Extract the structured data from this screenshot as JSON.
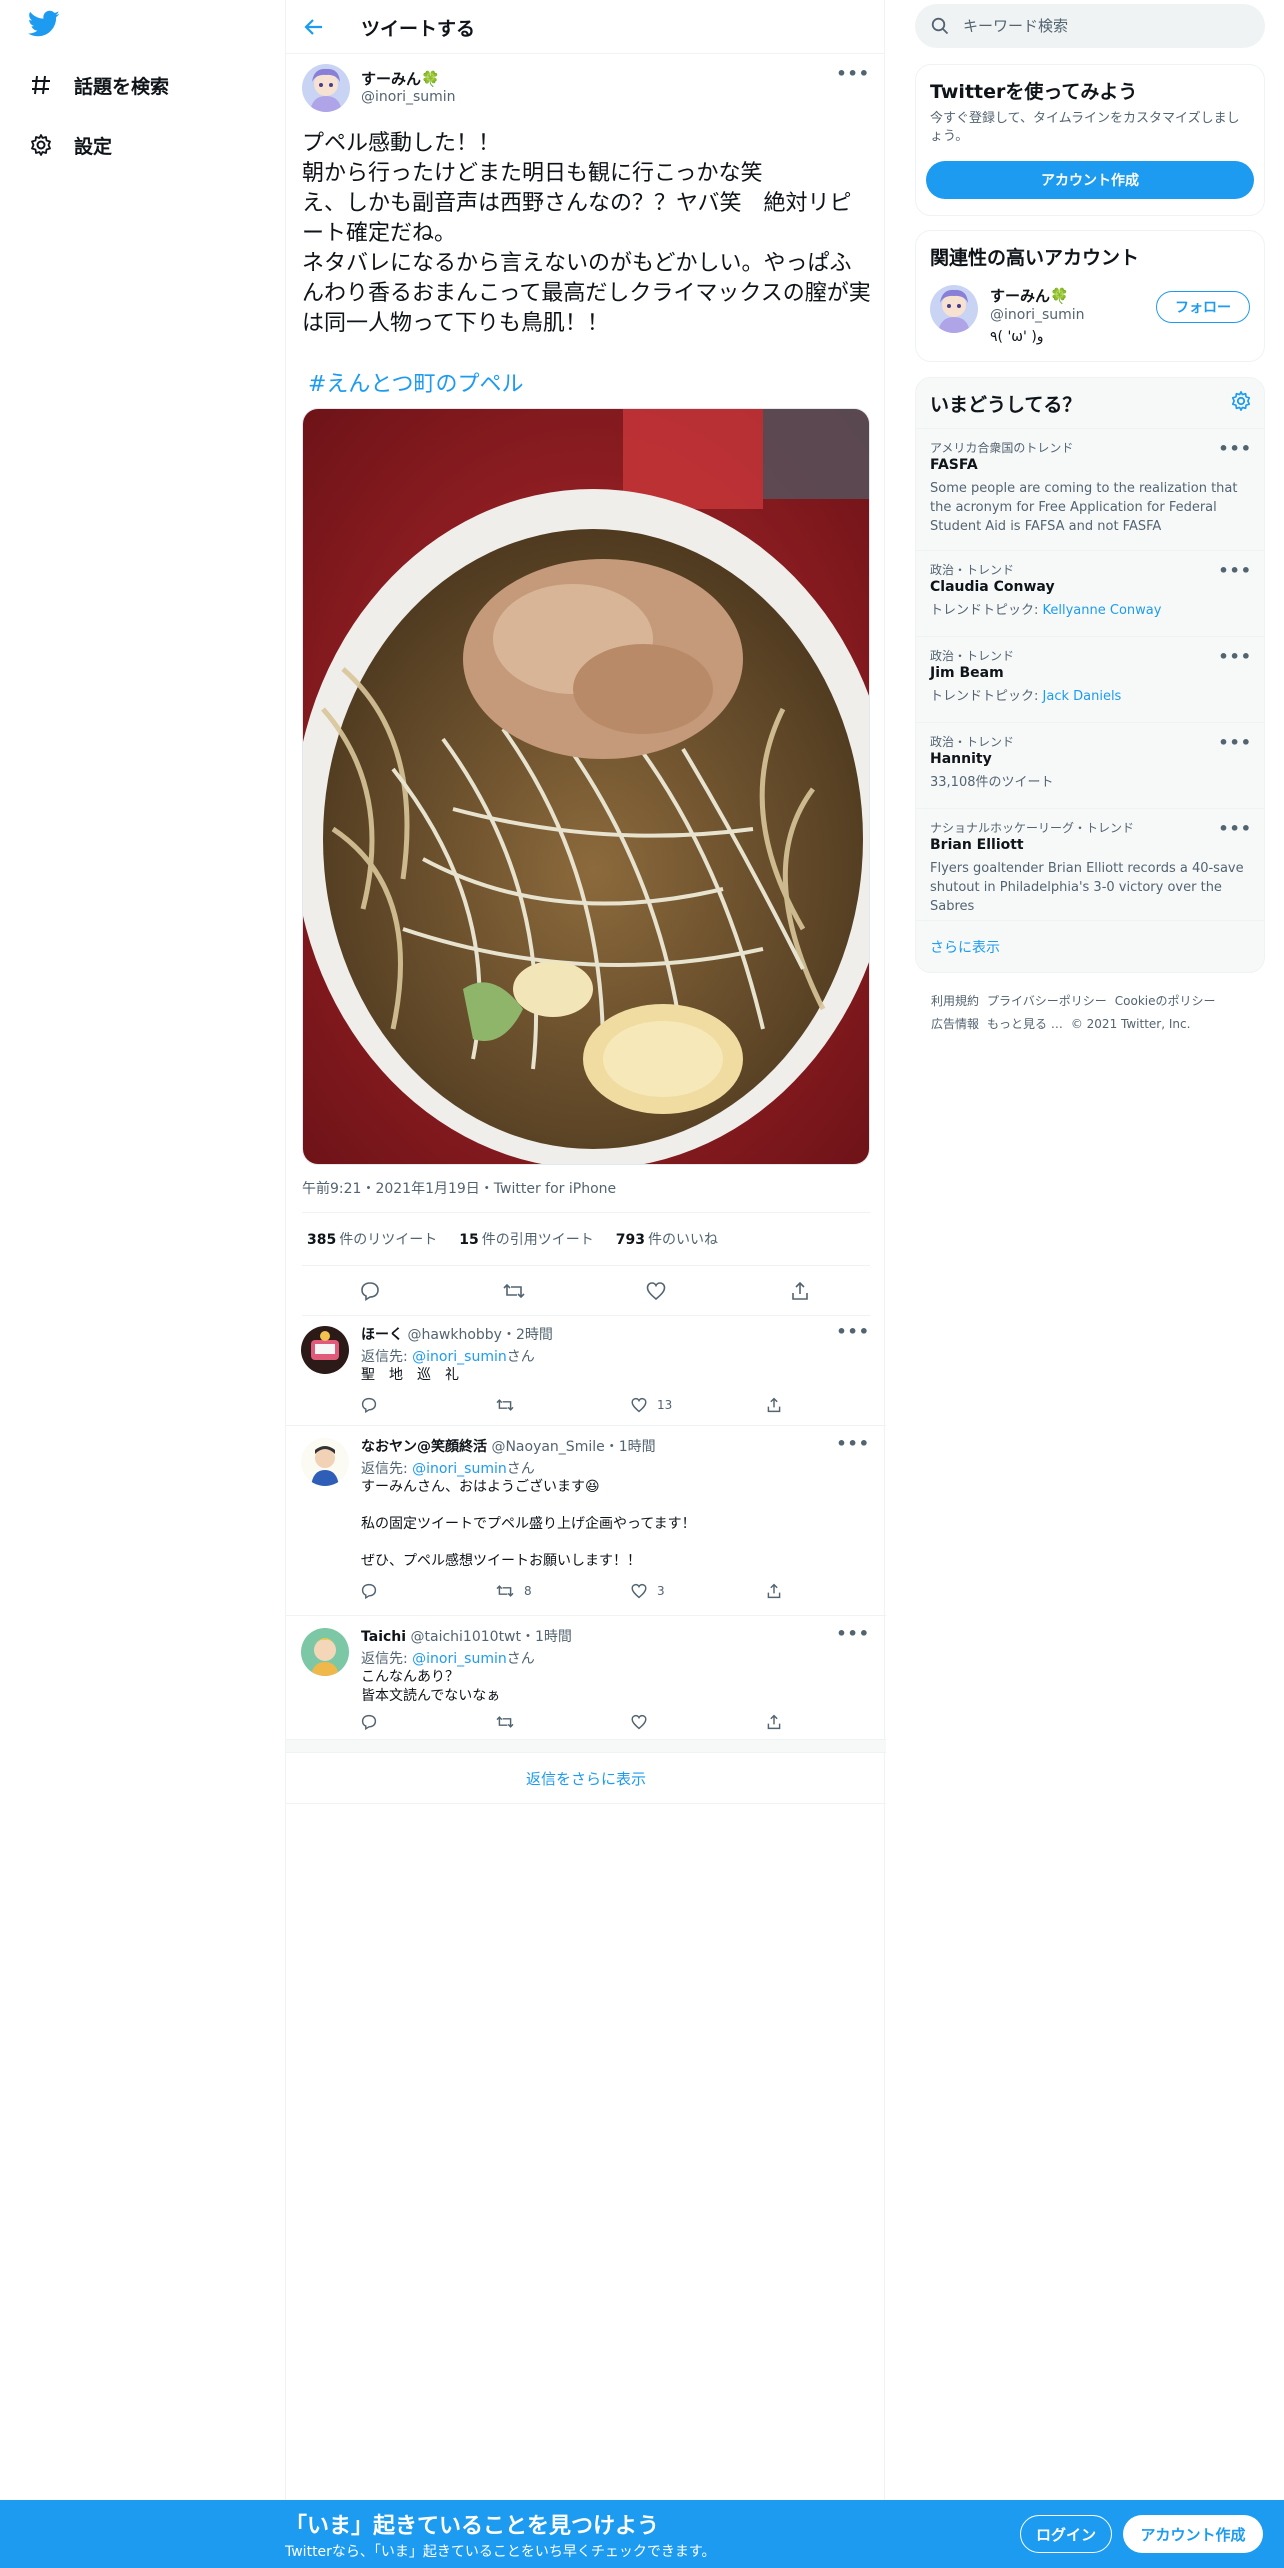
{
  "nav": {
    "logo": "twitter-bird-icon",
    "items": [
      {
        "label": "話題を検索",
        "icon": "hashtag-icon"
      },
      {
        "label": "設定",
        "icon": "gear-icon"
      }
    ]
  },
  "header": {
    "title": "ツイートする"
  },
  "tweet": {
    "name": "すーみん🍀",
    "handle": "@inori_sumin",
    "text": "プペル感動した！！\n朝から行ったけどまた明日も観に行こっかな笑\nえ、しかも副音声は西野さんなの？？ヤバ笑　絶対リピート確定だね。\nネタバレになるから言えないのがもどかしい。やっぱふんわり香るおまんこって最高だしクライマックスの膣が実は同一人物って下りも鳥肌！！",
    "hashtag": "#えんとつ町のプペル",
    "meta": "午前9:21・2021年1月19日・Twitter for iPhone",
    "stats": {
      "retweets_count": "385",
      "retweets_label": "件のリツイート",
      "quotes_count": "15",
      "quotes_label": "件の引用ツイート",
      "likes_count": "793",
      "likes_label": "件のいいね"
    }
  },
  "replies": [
    {
      "name": "ほーく",
      "handle": "@hawkhobby・2時間",
      "to_label": "返信先: ",
      "to_handle": "@inori_sumin",
      "to_suffix": "さん",
      "text": "聖　地　巡　礼",
      "retweets": "",
      "likes": "13"
    },
    {
      "name": "なおヤン@笑顔終活",
      "handle": "@Naoyan_Smile・1時間",
      "to_label": "返信先: ",
      "to_handle": "@inori_sumin",
      "to_suffix": "さん",
      "text": "すーみんさん、おはようございます😆\n\n私の固定ツイートでプペル盛り上げ企画やってます！\n\nぜひ、プペル感想ツイートお願いします！！",
      "retweets": "8",
      "likes": "3"
    },
    {
      "name": "Taichi",
      "handle": "@taichi1010twt・1時間",
      "to_label": "返信先: ",
      "to_handle": "@inori_sumin",
      "to_suffix": "さん",
      "text": "こんなんあり？\n皆本文読んでないなぁ",
      "retweets": "",
      "likes": ""
    }
  ],
  "show_more_replies": "返信をさらに表示",
  "sidebar": {
    "search_placeholder": "キーワード検索",
    "signup": {
      "title": "Twitterを使ってみよう",
      "desc": "今すぐ登録して、タイムラインをカスタマイズしましょう。",
      "button": "アカウント作成"
    },
    "relevant": {
      "title": "関連性の高いアカウント",
      "name": "すーみん🍀",
      "handle": "@inori_sumin",
      "bio": "٩( 'ω' )و",
      "follow": "フォロー"
    },
    "trends": {
      "title": "いまどうしてる？",
      "items": [
        {
          "context": "アメリカ合衆国のトレンド",
          "name": "FASFA",
          "desc": "Some people are coming to the realization that the acronym for Free Application for Federal Student Aid is FAFSA and not FASFA",
          "sub_label": "",
          "sub_link": ""
        },
        {
          "context": "政治・トレンド",
          "name": "Claudia Conway",
          "desc": "",
          "sub_label": "トレンドトピック: ",
          "sub_link": "Kellyanne Conway"
        },
        {
          "context": "政治・トレンド",
          "name": "Jim Beam",
          "desc": "",
          "sub_label": "トレンドトピック: ",
          "sub_link": "Jack Daniels"
        },
        {
          "context": "政治・トレンド",
          "name": "Hannity",
          "desc": "33,108件のツイート",
          "sub_label": "",
          "sub_link": ""
        },
        {
          "context": "ナショナルホッケーリーグ・トレンド",
          "name": "Brian Elliott",
          "desc": "Flyers goaltender Brian Elliott records a 40-save shutout in Philadelphia's 3-0 victory over the Sabres",
          "sub_label": "",
          "sub_link": ""
        }
      ],
      "show_more": "さらに表示"
    },
    "footer": [
      "利用規約",
      "プライバシーポリシー",
      "Cookieのポリシー",
      "広告情報",
      "もっと見る …",
      "© 2021 Twitter, Inc."
    ]
  },
  "bottom_bar": {
    "title": "「いま」起きていることを見つけよう",
    "subtitle": "Twitterなら、「いま」起きていることをいち早くチェックできます。",
    "login": "ログイン",
    "signup": "アカウント作成"
  },
  "colors": {
    "accent": "#1d9bf0",
    "text": "#0f1419",
    "muted": "#536471",
    "border": "#eff3f4"
  }
}
